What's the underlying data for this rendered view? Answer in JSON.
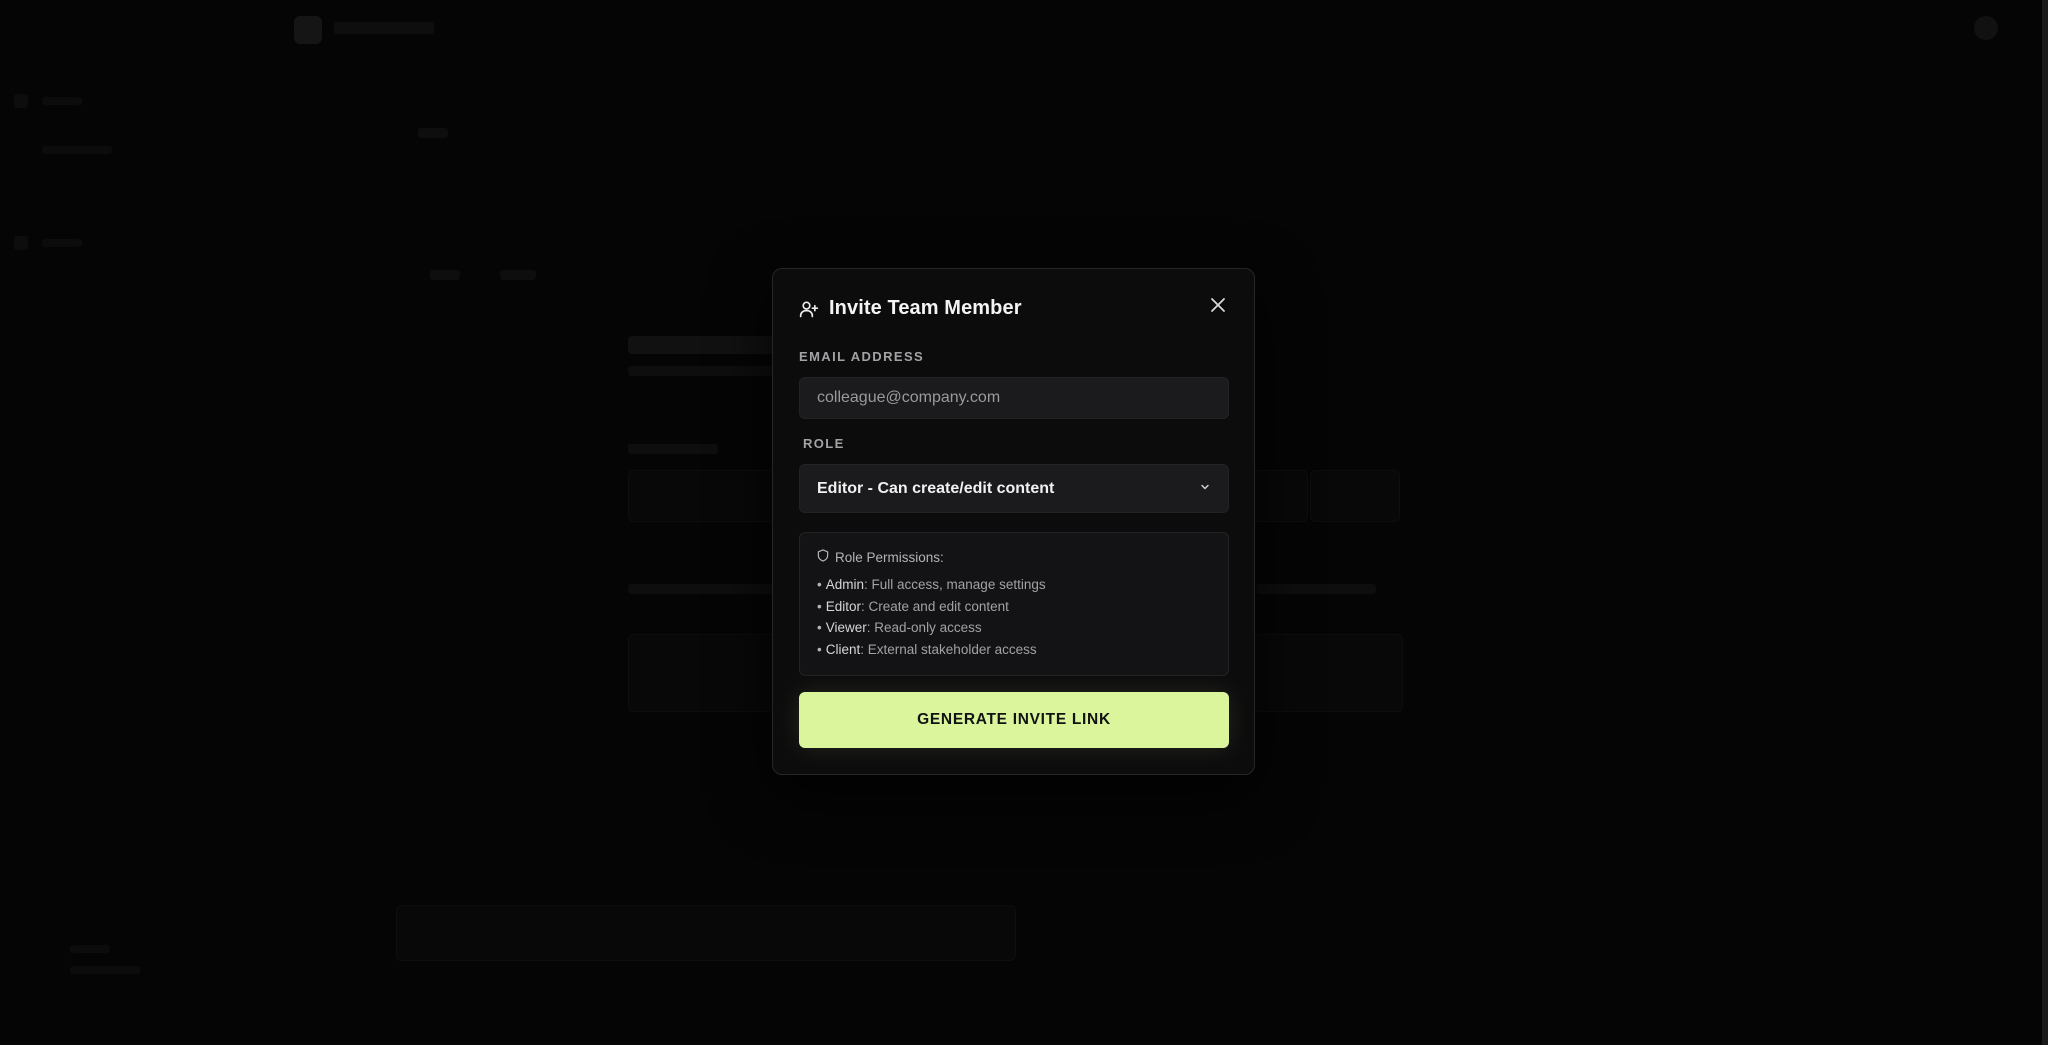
{
  "modal": {
    "title": "Invite Team Member",
    "email": {
      "label": "Email address",
      "value": "",
      "placeholder": "colleague@company.com"
    },
    "role": {
      "label": "Role",
      "selected": "Editor - Can create/edit content"
    },
    "permissions": {
      "title": "Role Permissions:",
      "items": [
        {
          "role": "Admin",
          "description": "Full access, manage settings"
        },
        {
          "role": "Editor",
          "description": "Create and edit content"
        },
        {
          "role": "Viewer",
          "description": "Read-only access"
        },
        {
          "role": "Client",
          "description": "External stakeholder access"
        }
      ]
    },
    "generate_button": "GENERATE INVITE LINK"
  },
  "colors": {
    "accent": "#daf59c",
    "modal_bg": "#0c0c0d",
    "input_bg": "#1b1b1d",
    "overlay": "#000000"
  },
  "icons": {
    "header": "user-plus-icon",
    "close": "close-icon",
    "select": "chevron-down-icon",
    "permissions": "shield-icon"
  }
}
